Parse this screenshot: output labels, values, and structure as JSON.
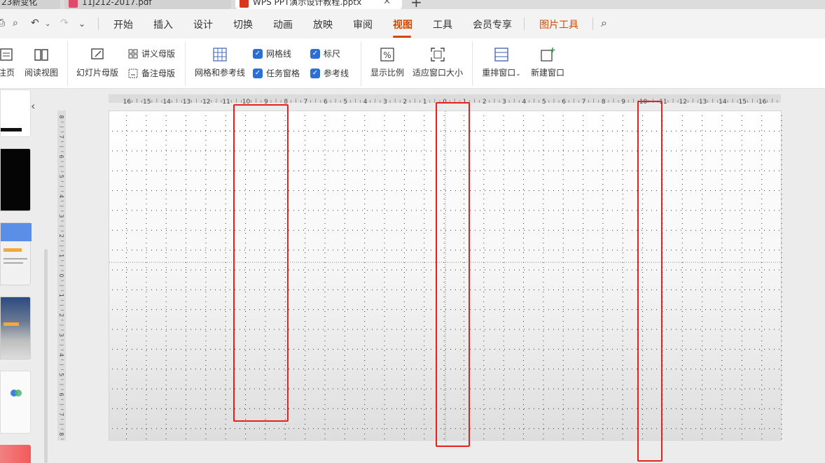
{
  "tabs": [
    {
      "label": "23新变化",
      "icon_color": ""
    },
    {
      "label": "11j212-2017.pdf",
      "icon_color": "#e04a6a"
    },
    {
      "label": "WPS PPT演示设计教程.pptx",
      "icon_color": "#d9351f"
    }
  ],
  "menubar": {
    "items": [
      "开始",
      "插入",
      "设计",
      "切换",
      "动画",
      "放映",
      "审阅",
      "视图",
      "工具",
      "会员专享",
      "图片工具"
    ],
    "active": "视图",
    "special": "图片工具"
  },
  "ribbon": {
    "notes_page": "注页",
    "reading_view": "阅读视图",
    "slide_master": "幻灯片母版",
    "handout_master": "讲义母版",
    "notes_master": "备注母版",
    "grid_guides": "网格和参考线",
    "gridlines": "网格线",
    "task_pane": "任务窗格",
    "ruler": "标尺",
    "guides": "参考线",
    "zoom": "显示比例",
    "fit_window": "适应窗口大小",
    "arrange_window": "重排窗口",
    "new_window": "新建窗口"
  },
  "hruler_labels": [
    "16",
    "15",
    "14",
    "13",
    "12",
    "11",
    "10",
    "9",
    "8",
    "7",
    "6",
    "5",
    "4",
    "3",
    "2",
    "1",
    "0",
    "1",
    "2",
    "3",
    "4",
    "5",
    "6",
    "7",
    "8",
    "9",
    "10",
    "11",
    "12",
    "13",
    "14",
    "15",
    "16"
  ],
  "vruler_labels": [
    "8",
    "7",
    "6",
    "5",
    "4",
    "3",
    "2",
    "1",
    "0",
    "1",
    "2",
    "3",
    "4",
    "5",
    "6",
    "7",
    "8"
  ],
  "colors": {
    "accent": "#d04a02",
    "checkbox": "#2b6fd6",
    "highlight": "#e8201c"
  }
}
